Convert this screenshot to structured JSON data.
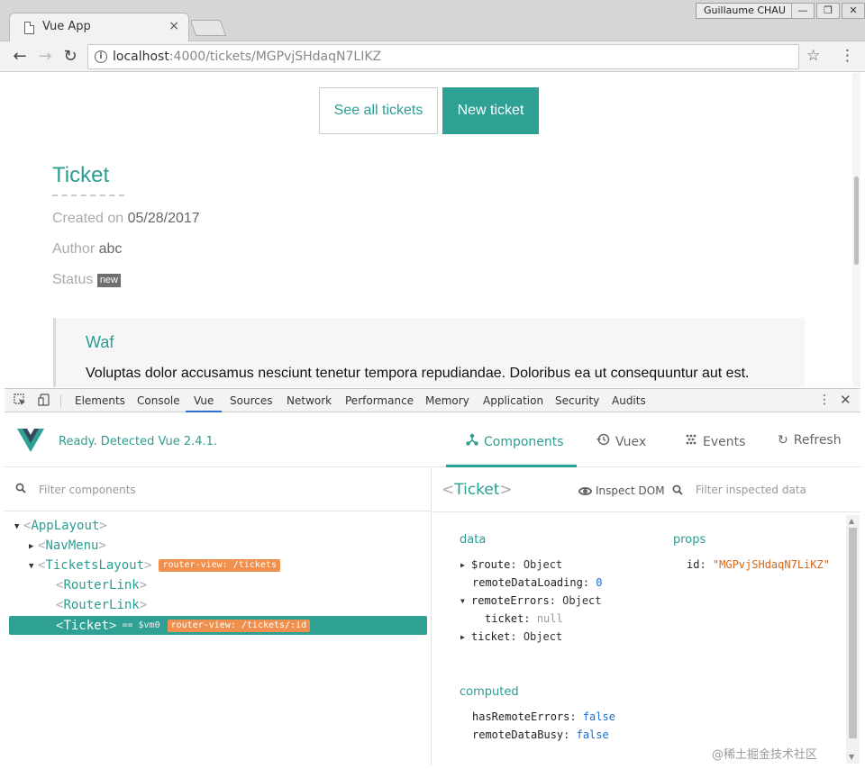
{
  "browser": {
    "tab_title": "Vue App",
    "tab_close": "×",
    "profile_name": "Guillaume CHAU",
    "url_host": "localhost",
    "url_rest": ":4000/tickets/MGPvjSHdaqN7LIKZ",
    "window_controls": {
      "minimize": "—",
      "restore": "❐",
      "close": "✕"
    }
  },
  "page": {
    "see_all_label": "See all tickets",
    "new_ticket_label": "New ticket",
    "title": "Ticket",
    "created_label": "Created on",
    "created_value": "05/28/2017",
    "author_label": "Author",
    "author_value": "abc",
    "status_label": "Status",
    "status_value": "new",
    "quote_title": "Waf",
    "quote_text": "Voluptas dolor accusamus nesciunt tenetur tempora repudiandae. Doloribus ea ut consequuntur aut est."
  },
  "devtools": {
    "tabs": [
      "Elements",
      "Console",
      "Vue",
      "Sources",
      "Network",
      "Performance",
      "Memory",
      "Application",
      "Security",
      "Audits"
    ],
    "active_tab": "Vue"
  },
  "vue": {
    "status": "Ready. Detected Vue 2.4.1.",
    "nav": {
      "components": "Components",
      "vuex": "Vuex",
      "events": "Events",
      "refresh": "Refresh"
    },
    "filter_components": "Filter components",
    "tree": [
      {
        "name": "AppLayout"
      },
      {
        "name": "NavMenu"
      },
      {
        "name": "TicketsLayout",
        "tag": "router-view: /tickets"
      },
      {
        "name": "RouterLink"
      },
      {
        "name": "RouterLink"
      },
      {
        "name": "Ticket",
        "vm": "== $vm0",
        "tag": "router-view: /tickets/:id"
      }
    ],
    "inspector": {
      "component": "Ticket",
      "inspect_dom": "Inspect DOM",
      "filter_data": "Filter inspected data",
      "data_heading": "data",
      "props_heading": "props",
      "computed_heading": "computed",
      "data": {
        "route_key": "$route",
        "route_val": "Object",
        "loading_key": "remoteDataLoading",
        "loading_val": "0",
        "errors_key": "remoteErrors",
        "errors_val": "Object",
        "ticket_child_key": "ticket",
        "ticket_child_val": "null",
        "ticket_key": "ticket",
        "ticket_val": "Object"
      },
      "props": {
        "id_key": "id",
        "id_val": "\"MGPvjSHdaqN7LiKZ\""
      },
      "computed": {
        "has_errors_key": "hasRemoteErrors",
        "has_errors_val": "false",
        "busy_key": "remoteDataBusy",
        "busy_val": "false"
      }
    }
  },
  "watermark": "@稀土掘金技术社区",
  "colors": {
    "accent": "#2ea094",
    "tag": "#f0904f",
    "devtools_blue": "#2f6fd1"
  }
}
